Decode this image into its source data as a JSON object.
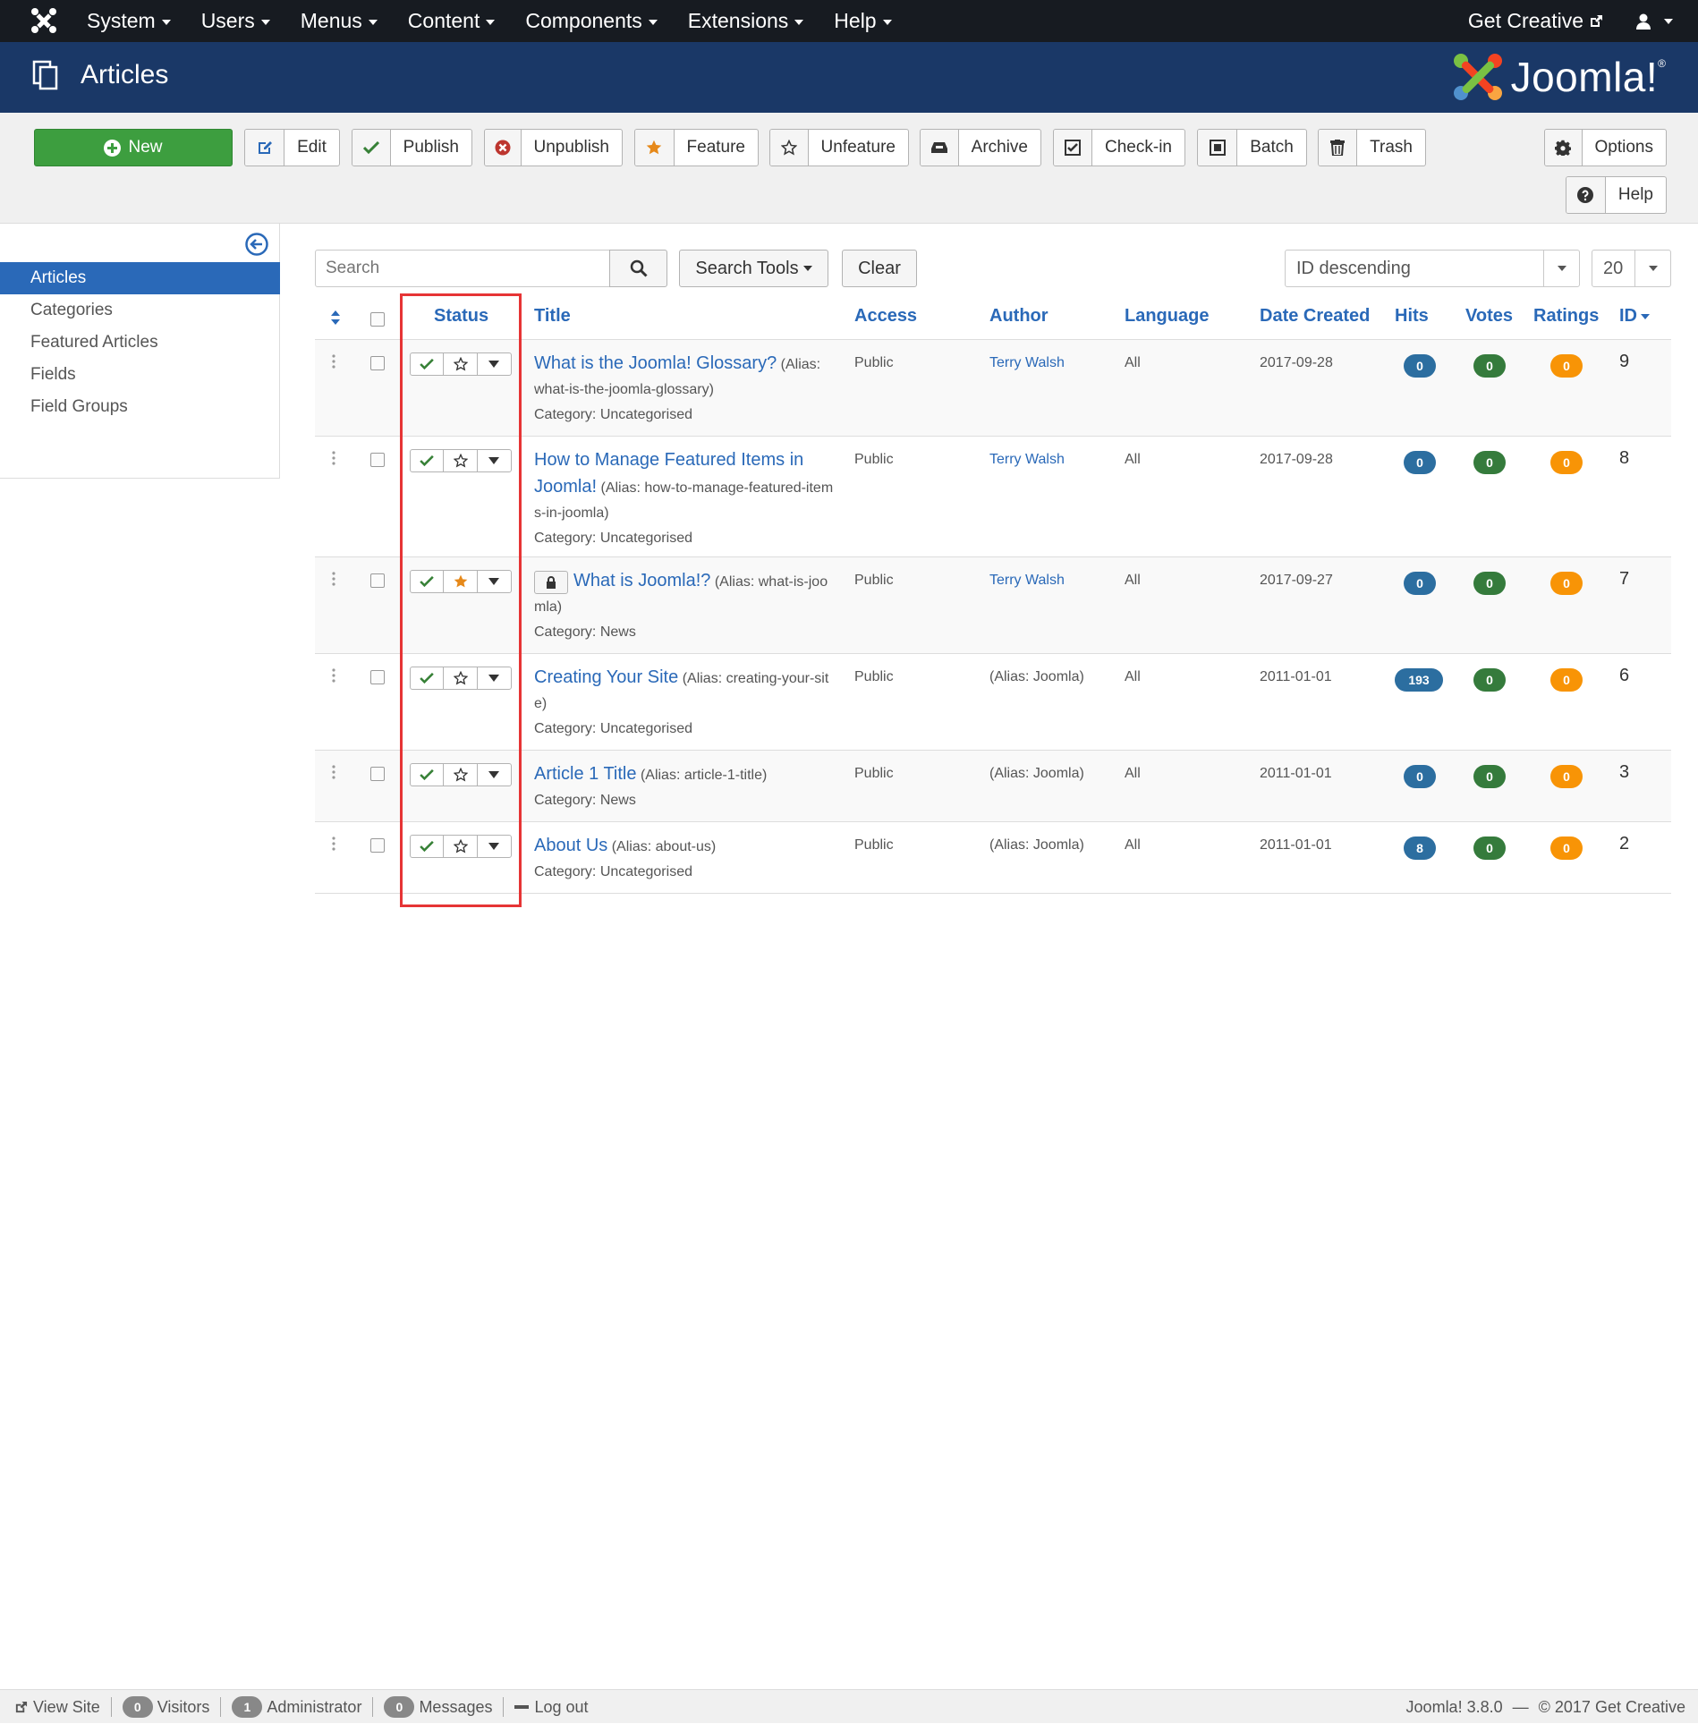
{
  "topbar": {
    "menu": [
      {
        "label": "System"
      },
      {
        "label": "Users"
      },
      {
        "label": "Menus"
      },
      {
        "label": "Content"
      },
      {
        "label": "Components"
      },
      {
        "label": "Extensions"
      },
      {
        "label": "Help"
      }
    ],
    "site_link": "Get Creative",
    "icons": {
      "logo": "joomla-icon",
      "external": "external-link-icon",
      "user": "user-icon"
    }
  },
  "header": {
    "title": "Articles",
    "brand": "Joomla!",
    "icon": "copy-icon"
  },
  "toolbar": {
    "new": "New",
    "edit": "Edit",
    "publish": "Publish",
    "unpublish": "Unpublish",
    "feature": "Feature",
    "unfeature": "Unfeature",
    "archive": "Archive",
    "checkin": "Check-in",
    "batch": "Batch",
    "trash": "Trash",
    "options": "Options",
    "help": "Help"
  },
  "sidebar": {
    "items": [
      {
        "label": "Articles",
        "active": true
      },
      {
        "label": "Categories",
        "active": false
      },
      {
        "label": "Featured Articles",
        "active": false
      },
      {
        "label": "Fields",
        "active": false
      },
      {
        "label": "Field Groups",
        "active": false
      }
    ]
  },
  "filters": {
    "search_placeholder": "Search",
    "search_tools": "Search Tools",
    "clear": "Clear",
    "ordering": "ID descending",
    "limit": "20"
  },
  "table": {
    "headers": {
      "status": "Status",
      "title": "Title",
      "access": "Access",
      "author": "Author",
      "language": "Language",
      "date": "Date Created",
      "hits": "Hits",
      "votes": "Votes",
      "ratings": "Ratings",
      "id": "ID"
    },
    "rows": [
      {
        "title": "What is the Joomla! Glossary?",
        "alias": "(Alias: what-is-the-joomla-glossary)",
        "category": "Category: Uncategorised",
        "access": "Public",
        "author": "Terry Walsh",
        "language": "All",
        "date": "2017-09-28",
        "hits": "0",
        "votes": "0",
        "ratings": "0",
        "id": "9",
        "featured": false,
        "locked": false
      },
      {
        "title": "How to Manage Featured Items in Joomla!",
        "alias": "(Alias: how-to-manage-featured-items-in-joomla)",
        "category": "Category: Uncategorised",
        "access": "Public",
        "author": "Terry Walsh",
        "language": "All",
        "date": "2017-09-28",
        "hits": "0",
        "votes": "0",
        "ratings": "0",
        "id": "8",
        "featured": false,
        "locked": false
      },
      {
        "title": "What is Joomla!?",
        "alias": "(Alias: what-is-joomla)",
        "category": "Category: News",
        "access": "Public",
        "author": "Terry Walsh",
        "language": "All",
        "date": "2017-09-27",
        "hits": "0",
        "votes": "0",
        "ratings": "0",
        "id": "7",
        "featured": true,
        "locked": true
      },
      {
        "title": "Creating Your Site",
        "alias": "(Alias: creating-your-site)",
        "category": "Category: Uncategorised",
        "access": "Public",
        "author": "(Alias: Joomla)",
        "language": "All",
        "date": "2011-01-01",
        "hits": "193",
        "votes": "0",
        "ratings": "0",
        "id": "6",
        "featured": false,
        "locked": false
      },
      {
        "title": "Article 1 Title",
        "alias": "(Alias: article-1-title)",
        "category": "Category: News",
        "access": "Public",
        "author": "(Alias: Joomla)",
        "language": "All",
        "date": "2011-01-01",
        "hits": "0",
        "votes": "0",
        "ratings": "0",
        "id": "3",
        "featured": false,
        "locked": false
      },
      {
        "title": "About Us",
        "alias": "(Alias: about-us)",
        "category": "Category: Uncategorised",
        "access": "Public",
        "author": "(Alias: Joomla)",
        "language": "All",
        "date": "2011-01-01",
        "hits": "8",
        "votes": "0",
        "ratings": "0",
        "id": "2",
        "featured": false,
        "locked": false
      }
    ]
  },
  "footer": {
    "view_site": "View Site",
    "visitors_count": "0",
    "visitors": "Visitors",
    "admins_count": "1",
    "admins": "Administrator",
    "messages_count": "0",
    "messages": "Messages",
    "logout": "Log out",
    "version": "Joomla! 3.8.0",
    "dash": "—",
    "copyright": "© 2017 Get Creative"
  },
  "colors": {
    "accent": "#2a69b8",
    "header": "#1a3867",
    "topbar": "#171b21",
    "new_button": "#3d9e3f",
    "highlight": "#e63435"
  }
}
